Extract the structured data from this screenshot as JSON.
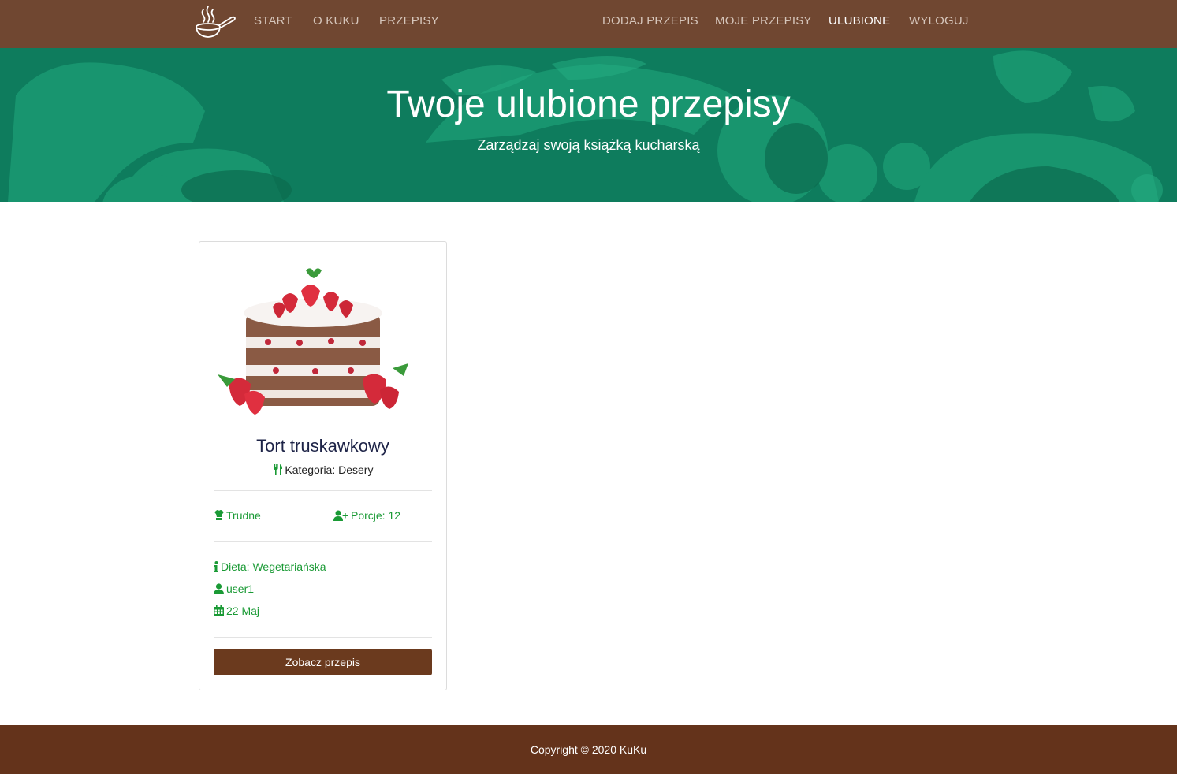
{
  "nav": {
    "left": [
      "START",
      "O KUKU",
      "PRZEPISY"
    ],
    "right": [
      "DODAJ PRZEPIS",
      "MOJE PRZEPISY",
      "ULUBIONE",
      "WYLOGUJ"
    ],
    "active": "ULUBIONE",
    "logo_icon": "frying-pan-icon"
  },
  "hero": {
    "title": "Twoje ulubione przepisy",
    "subtitle": "Zarządzaj swoją książką kucharską"
  },
  "card": {
    "title": "Tort truskawkowy",
    "category": "Kategoria: Desery",
    "difficulty": "Trudne",
    "portions": "Porcje: 12",
    "diet": "Dieta: Wegetariańska",
    "author": "user1",
    "date": "22 Maj",
    "button": "Zobacz przepis",
    "icons": {
      "category": "utensils-icon",
      "difficulty": "chef-icon",
      "portions": "user-plus-icon",
      "diet": "info-icon",
      "author": "user-icon",
      "date": "calendar-icon"
    }
  },
  "footer": {
    "copyright": "Copyright © 2020 KuKu"
  },
  "colors": {
    "navbar": "#704731",
    "hero_overlay": "#0f7a5c",
    "accent_green": "#1a9a35",
    "button": "#6b3a1e",
    "footer": "#64331b"
  }
}
